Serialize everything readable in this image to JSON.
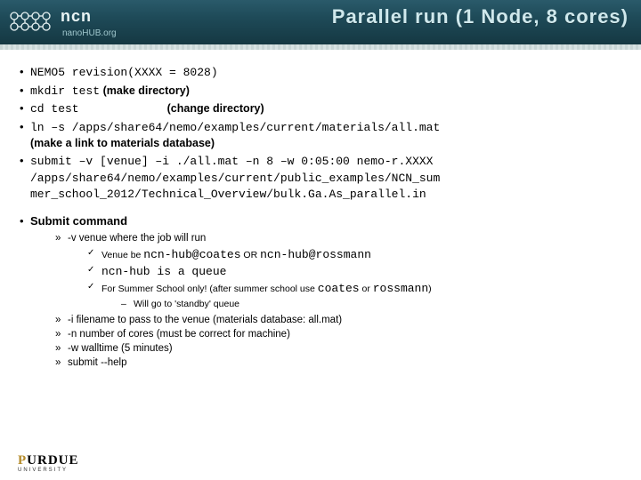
{
  "header": {
    "brand": "ncn",
    "brand_sub": "nanoHUB.org",
    "title": "Parallel run (1 Node, 8 cores)"
  },
  "bullets": {
    "b1": {
      "cmd": "NEMO5 revision(XXXX = 8028)"
    },
    "b2": {
      "cmd": "mkdir test",
      "ann": " (make directory)"
    },
    "b3": {
      "cmd": "cd test",
      "ann": "(change directory)"
    },
    "b4": {
      "cmd": "ln –s /apps/share64/nemo/examples/current/materials/all.mat",
      "ann": "(make a link to materials database)"
    },
    "b5": {
      "l1": "submit –v [venue] –i ./all.mat –n 8 –w 0:05:00 nemo-r.XXXX",
      "l2": "/apps/share64/nemo/examples/current/public_examples/NCN_sum",
      "l3": "mer_school_2012/Technical_Overview/bulk.Ga.As_parallel.in"
    },
    "b6": {
      "label": "Submit command"
    }
  },
  "sub": {
    "v": "-v venue where the job will run",
    "c1_a": "Venue be ",
    "c1_b": "ncn-hub@coates",
    "c1_c": " OR ",
    "c1_d": "ncn-hub@rossmann",
    "c2": "ncn-hub is a queue",
    "c3_a": "For Summer School only! (after summer school use ",
    "c3_b": "coates",
    "c3_c": " or ",
    "c3_d": "rossmann",
    "c3_e": ")",
    "d1": "Will go to 'standby' queue",
    "i": "-i filename to pass to the venue (materials database: all.mat)",
    "n": "-n number of cores (must be correct for machine)",
    "w": "-w walltime (5 minutes)",
    "help": "submit --help"
  },
  "footer": {
    "l1_a": "P",
    "l1_b": "URDUE",
    "l2": "UNIVERSITY"
  }
}
